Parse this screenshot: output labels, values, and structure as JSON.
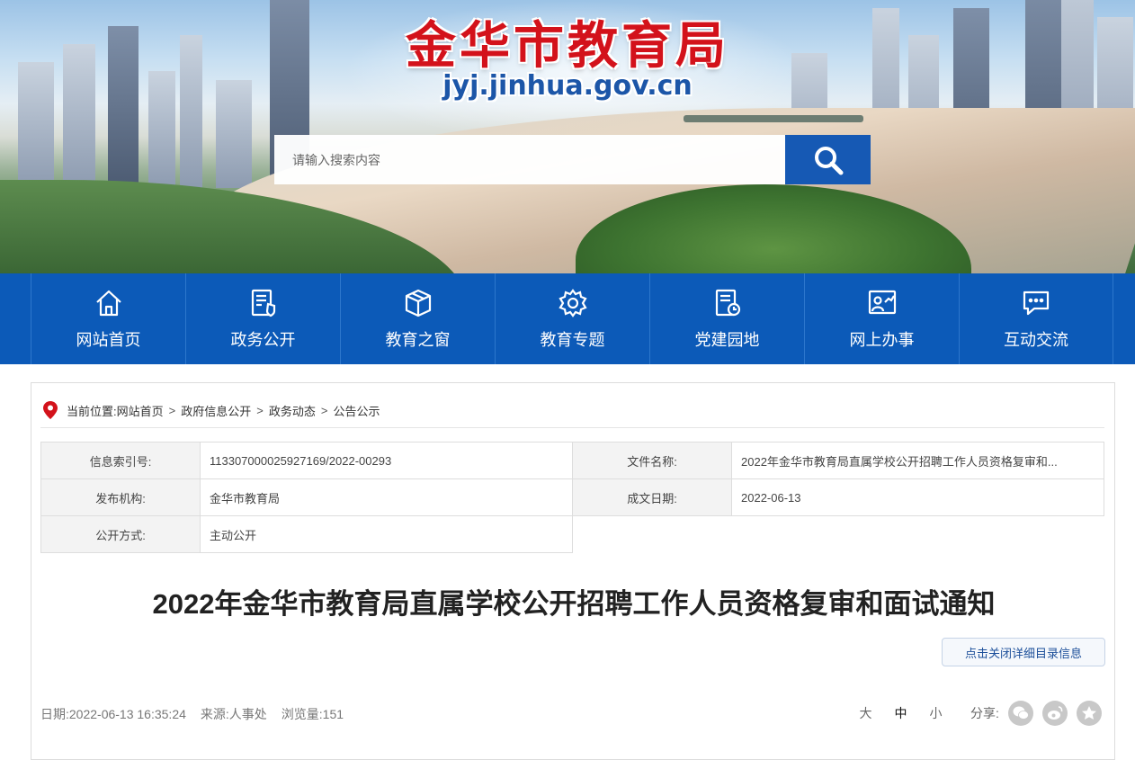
{
  "header": {
    "site_title": "金华市教育局",
    "site_domain": "jyj.jinhua.gov.cn",
    "search_placeholder": "请输入搜索内容"
  },
  "nav": {
    "items": [
      {
        "label": "网站首页",
        "icon": "home-icon"
      },
      {
        "label": "政务公开",
        "icon": "document-shield-icon"
      },
      {
        "label": "教育之窗",
        "icon": "box-icon"
      },
      {
        "label": "教育专题",
        "icon": "gear-icon"
      },
      {
        "label": "党建园地",
        "icon": "document-clock-icon"
      },
      {
        "label": "网上办事",
        "icon": "user-chart-icon"
      },
      {
        "label": "互动交流",
        "icon": "chat-icon"
      }
    ]
  },
  "breadcrumb": {
    "prefix": "当前位置:",
    "items": [
      "网站首页",
      "政府信息公开",
      "政务动态",
      "公告公示"
    ],
    "separator": ">"
  },
  "meta": {
    "index_label": "信息索引号:",
    "index_value": "113307000025927169/2022-00293",
    "filename_label": "文件名称:",
    "filename_value": "2022年金华市教育局直属学校公开招聘工作人员资格复审和...",
    "publisher_label": "发布机构:",
    "publisher_value": "金华市教育局",
    "date_label": "成文日期:",
    "date_value": "2022-06-13",
    "disclosure_label": "公开方式:",
    "disclosure_value": "主动公开"
  },
  "article": {
    "title": "2022年金华市教育局直属学校公开招聘工作人员资格复审和面试通知",
    "toggle_label": "点击关闭详细目录信息",
    "date_text": "日期:2022-06-13 16:35:24",
    "source_text": "来源:人事处",
    "views_text": "浏览量:151"
  },
  "tools": {
    "font_large": "大",
    "font_medium": "中",
    "font_small": "小",
    "share_label": "分享:",
    "share_icons": [
      "wechat-icon",
      "weibo-icon",
      "favorite-icon"
    ]
  },
  "colors": {
    "nav_bg": "#0c5ab8",
    "title_red": "#d3121b",
    "search_button": "#1659b4"
  }
}
